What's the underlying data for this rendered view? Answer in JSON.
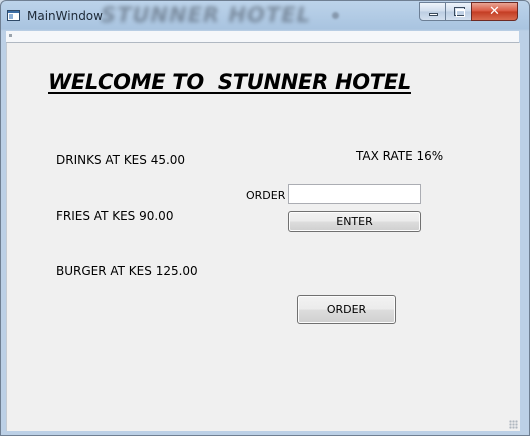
{
  "window": {
    "title": "MainWindow",
    "titlebar_blurred_text": "STUNNER HOTEL",
    "controls": {
      "minimize_icon": "minimize-icon",
      "maximize_icon": "maximize-icon",
      "close_icon": "close-icon",
      "close_glyph": "✕"
    },
    "app_icon": "app-window-icon"
  },
  "main": {
    "heading": "WELCOME TO  STUNNER HOTEL",
    "menu": [
      {
        "label": "DRINKS AT KES 45.00"
      },
      {
        "label": "FRIES AT KES 90.00"
      },
      {
        "label": "BURGER AT KES 125.00"
      }
    ],
    "tax_rate_label": "TAX RATE 16%",
    "order_field": {
      "label": "ORDER",
      "value": "",
      "placeholder": ""
    },
    "enter_button_label": "ENTER",
    "order_button_label": "ORDER"
  },
  "colors": {
    "titlebar": "#a9c4e0",
    "client_bg": "#f0f0f0",
    "close_button": "#c33b22"
  }
}
